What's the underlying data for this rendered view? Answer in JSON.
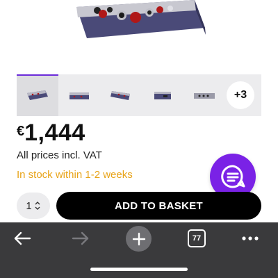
{
  "product": {
    "thumbnails": [
      "audio-interface-angle-left",
      "audio-interface-front",
      "audio-interface-angle-right",
      "audio-interface-side",
      "audio-interface-back"
    ],
    "more_images": "+3",
    "price_currency": "€",
    "price_amount": "1,444",
    "vat_note": "All prices incl. VAT",
    "stock_status": "In stock within 1-2 weeks"
  },
  "cart": {
    "quantity": "1",
    "add_to_basket": "ADD TO BASKET"
  },
  "browser": {
    "tab_count": "77"
  },
  "colors": {
    "accent_purple": "#7a22e6",
    "stock_orange": "#e8a317",
    "toolbar_bg": "#3a3a3c"
  }
}
